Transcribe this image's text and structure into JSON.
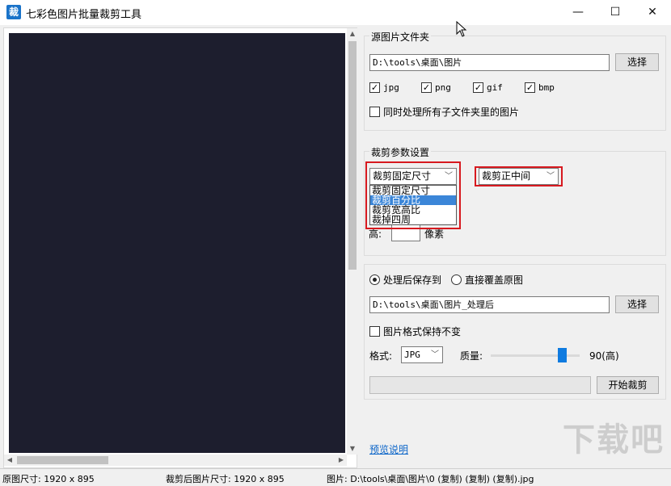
{
  "window": {
    "icon_char": "裁",
    "title": "七彩色图片批量裁剪工具",
    "minimize": "—",
    "maximize": "☐",
    "close": "✕"
  },
  "source": {
    "group_title": "源图片文件夹",
    "path": "D:\\tools\\桌面\\图片",
    "browse": "选择",
    "formats": [
      {
        "label": "jpg",
        "checked": true
      },
      {
        "label": "png",
        "checked": true
      },
      {
        "label": "gif",
        "checked": true
      },
      {
        "label": "bmp",
        "checked": true
      }
    ],
    "subfolders": {
      "label": "同时处理所有子文件夹里的图片",
      "checked": false
    }
  },
  "crop": {
    "group_title": "裁剪参数设置",
    "mode_selected": "裁剪固定尺寸",
    "mode_options": [
      "裁剪固定尺寸",
      "裁剪百分比",
      "裁剪宽高比",
      "裁掉四周"
    ],
    "highlighted_option": 1,
    "position_selected": "裁剪正中间",
    "height_label": "高:",
    "height_value": "",
    "pixel_unit": "像素"
  },
  "output": {
    "save_radio": {
      "label": "处理后保存到",
      "selected": true
    },
    "overwrite_radio": {
      "label": "直接覆盖原图",
      "selected": false
    },
    "path": "D:\\tools\\桌面\\图片_处理后",
    "browse": "选择",
    "keep_format": {
      "label": "图片格式保持不变",
      "checked": false
    },
    "format_label": "格式:",
    "format_value": "JPG",
    "quality_label": "质量:",
    "quality_value": 90,
    "quality_text": "90(高)",
    "progress": 0,
    "start": "开始裁剪"
  },
  "preview_link": "预览说明",
  "status": {
    "original": "原图尺寸: 1920 x 895",
    "cropped": "裁剪后图片尺寸: 1920 x 895",
    "file": "图片: D:\\tools\\桌面\\图片\\0 (复制) (复制) (复制).jpg"
  },
  "watermark": "下载吧",
  "colors": {
    "highlight": "#d7191f",
    "accent": "#0f7be0",
    "selection": "#3b86d8"
  }
}
